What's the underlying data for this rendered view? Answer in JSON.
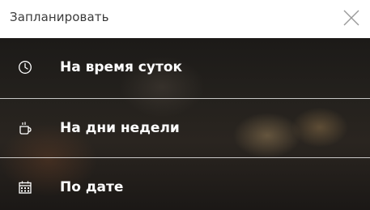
{
  "dialog": {
    "title": "Запланировать",
    "close_icon": "close-icon"
  },
  "menu": {
    "items": [
      {
        "label": "На время суток",
        "icon": "clock-icon"
      },
      {
        "label": "На дни недели",
        "icon": "coffee-cup-icon"
      },
      {
        "label": "По дате",
        "icon": "calendar-icon"
      }
    ]
  }
}
